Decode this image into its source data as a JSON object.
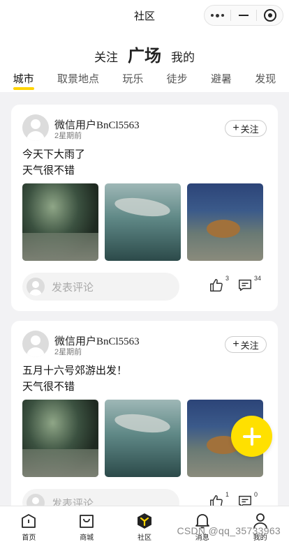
{
  "topbar": {
    "title": "社区"
  },
  "header": {
    "main_tabs": [
      "关注",
      "广场",
      "我的"
    ],
    "sub_tabs": [
      "城市",
      "取景地点",
      "玩乐",
      "徒步",
      "避暑",
      "发现"
    ]
  },
  "posts": [
    {
      "username": "微信用户BnCl5563",
      "time": "2星期前",
      "follow_label": "关注",
      "lines": [
        "今天下大雨了",
        "天气很不错"
      ],
      "comment_placeholder": "发表评论",
      "likes": "3",
      "comments": "34"
    },
    {
      "username": "微信用户BnCl5563",
      "time": "2星期前",
      "follow_label": "关注",
      "lines": [
        "五月十六号郊游出发！",
        "天气很不错"
      ],
      "comment_placeholder": "发表评论",
      "likes": "1",
      "comments": "0"
    }
  ],
  "tabbar": [
    "首页",
    "商城",
    "社区",
    "消息",
    "我的"
  ],
  "watermark": "CSDN @qq_35733963",
  "colors": {
    "accent": "#ffd400",
    "fab": "#ffe000"
  }
}
